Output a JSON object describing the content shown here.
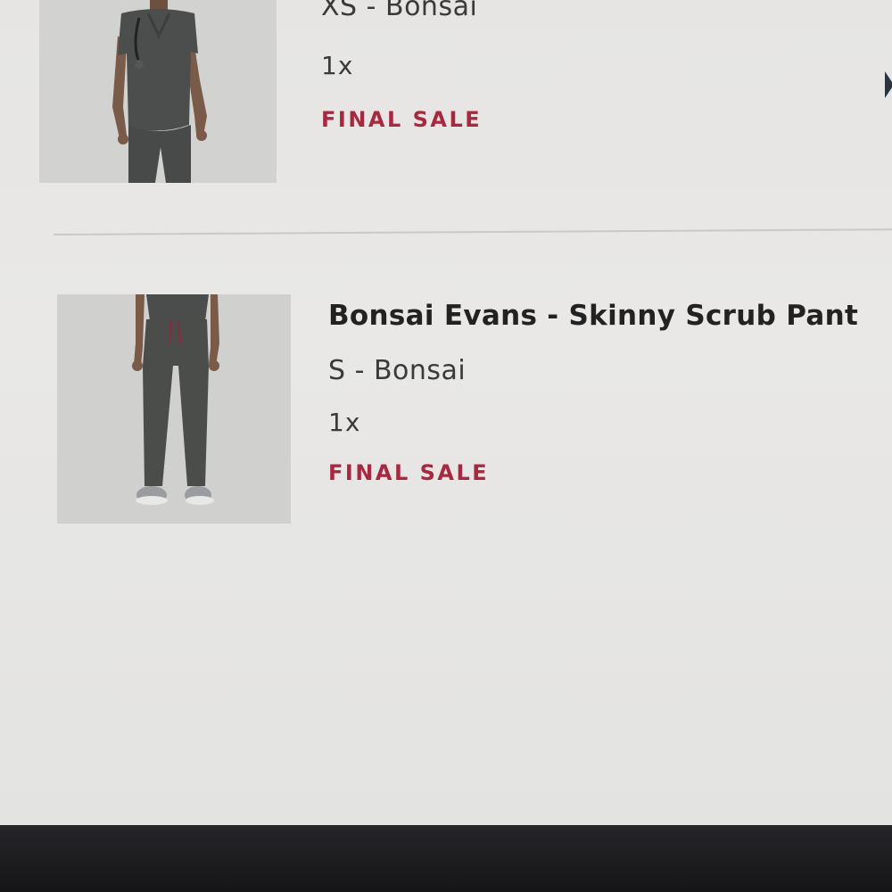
{
  "cart": {
    "items": [
      {
        "name": "",
        "variant": "XS - Bonsai",
        "quantity": "1x",
        "sale_label": "FINAL SALE",
        "image_icon": "scrub-top-model-photo"
      },
      {
        "name": "Bonsai Evans - Skinny Scrub Pant",
        "variant": "S - Bonsai",
        "quantity": "1x",
        "sale_label": "FINAL SALE",
        "image_icon": "scrub-pant-model-photo"
      }
    ]
  },
  "colors": {
    "sale_text": "#a8283f",
    "product_text": "#222222",
    "scrub_fabric": "#4a4d4a",
    "page_background": "#e7e6e4"
  }
}
